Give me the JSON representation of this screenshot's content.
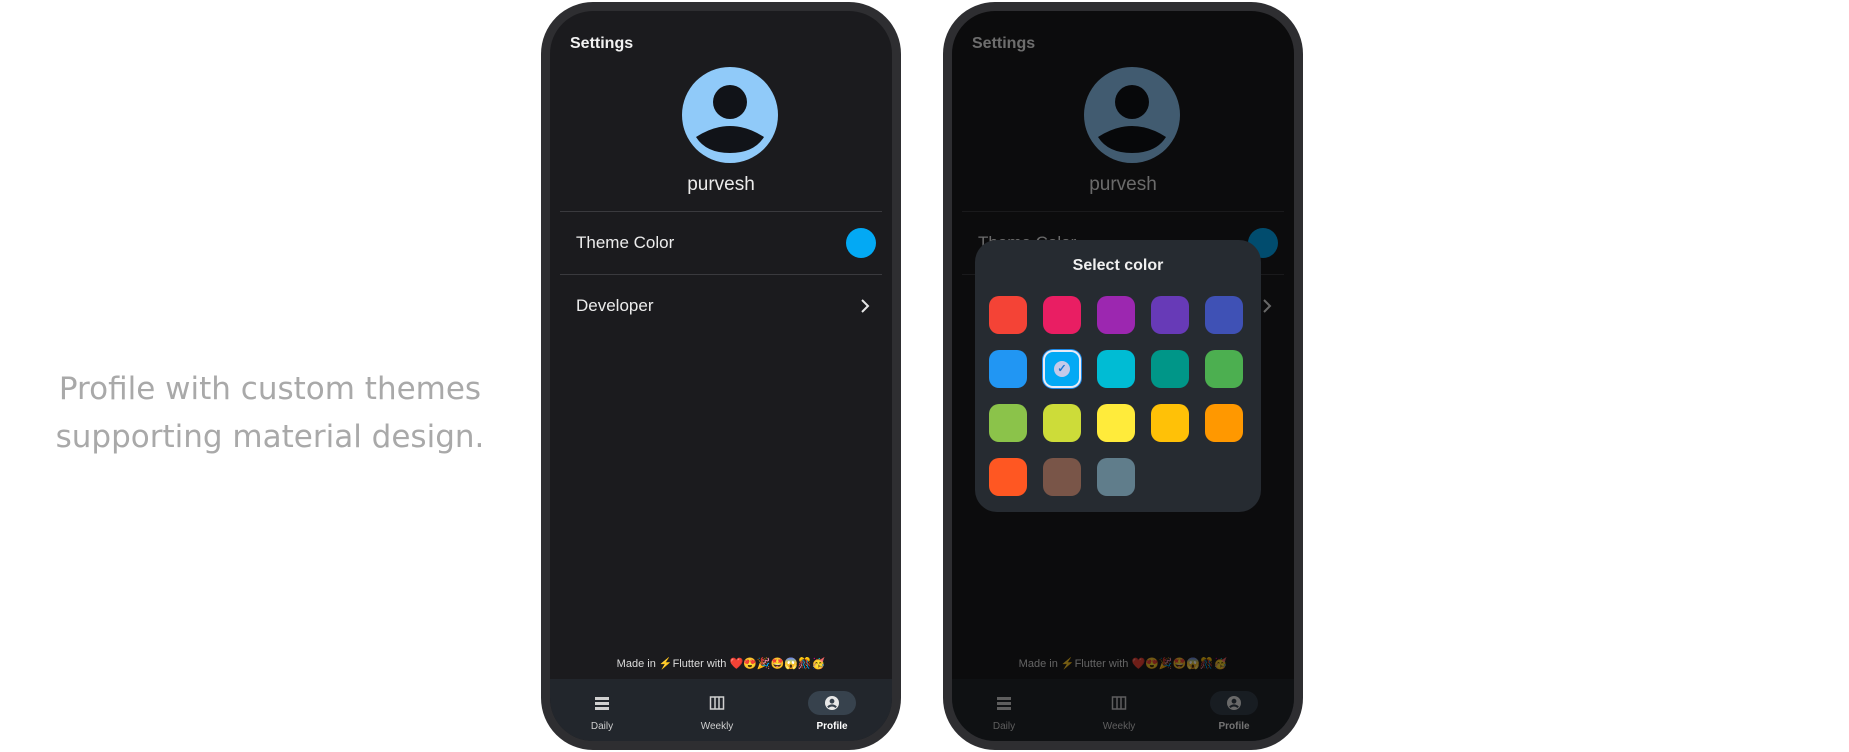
{
  "tagline": "Profile with custom themes supporting material design.",
  "screen": {
    "title": "Settings",
    "username": "purvesh",
    "theme_row_label": "Theme Color",
    "theme_color": "#03a9f4",
    "developer_row_label": "Developer",
    "made_in_prefix": "Made in",
    "made_in_flutter": "Flutter",
    "made_in_with": "with",
    "made_in_emojis": "❤️😍🎉🤩😱🎊🥳",
    "nav": [
      {
        "label": "Daily",
        "icon": "daily-icon",
        "active": false
      },
      {
        "label": "Weekly",
        "icon": "weekly-icon",
        "active": false
      },
      {
        "label": "Profile",
        "icon": "profile-icon",
        "active": true
      }
    ]
  },
  "dialog": {
    "title": "Select color",
    "selected_color": "#03a9f4",
    "colors": [
      "#f44336",
      "#e91e63",
      "#9c27b0",
      "#673ab7",
      "#3f51b5",
      "#2196f3",
      "#03a9f4",
      "#00bcd4",
      "#009688",
      "#4caf50",
      "#8bc34a",
      "#cddc39",
      "#ffeb3b",
      "#ffc107",
      "#ff9800",
      "#ff5722",
      "#795548",
      "#607d8b"
    ]
  }
}
